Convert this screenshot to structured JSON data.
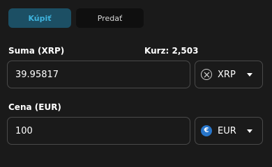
{
  "tabs": {
    "buy_label": "Kúpiť",
    "sell_label": "Predať",
    "active": "buy"
  },
  "amount": {
    "label": "Suma (XRP)",
    "rate_text": "Kurz: 2,503",
    "value": "39.95817",
    "currency": {
      "code": "XRP",
      "icon": "xrp-icon"
    }
  },
  "price": {
    "label": "Cena (EUR)",
    "value": "100",
    "currency": {
      "code": "EUR",
      "icon": "euro-icon",
      "icon_glyph": "€",
      "color": "#2775ca"
    }
  },
  "colors": {
    "accent": "#3fb4de",
    "accent_bg": "#1c4f64",
    "background": "#1a1a1a",
    "border": "#4a4a4a"
  }
}
